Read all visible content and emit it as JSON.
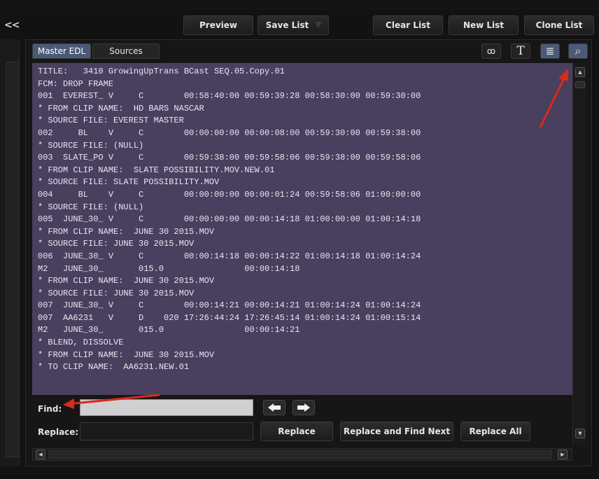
{
  "window": {
    "back_label": "<<"
  },
  "toolbar": {
    "preview": "Preview",
    "save_list": "Save List",
    "clear_list": "Clear List",
    "new_list": "New List",
    "clone_list": "Clone List"
  },
  "tabs": [
    {
      "label": "Master EDL",
      "active": true
    },
    {
      "label": "Sources",
      "active": false
    }
  ],
  "view_tools": [
    {
      "icon": "tape-icon",
      "glyph": "ꝏ",
      "active": false
    },
    {
      "icon": "text-icon",
      "glyph": "T",
      "active": false
    },
    {
      "icon": "edit-list-icon",
      "glyph": "≣",
      "active": true
    },
    {
      "icon": "search-icon",
      "glyph": "⌕",
      "active": true
    }
  ],
  "edl_lines": [
    "TITLE:   3410 GrowingUpTrans BCast SEQ.05.Copy.01",
    "FCM: DROP FRAME",
    "001  EVEREST_ V     C        00:58:40:00 00:59:39:28 00:58:30:00 00:59:30:00",
    "* FROM CLIP NAME:  HD BARS NASCAR",
    "* SOURCE FILE: EVEREST MASTER",
    "002     BL    V     C        00:00:00:00 00:00:08:00 00:59:30:00 00:59:38:00",
    "* SOURCE FILE: (NULL)",
    "003  SLATE_PO V     C        00:59:38:00 00:59:58:06 00:59:38:00 00:59:58:06",
    "* FROM CLIP NAME:  SLATE POSSIBILITY.MOV.NEW.01",
    "* SOURCE FILE: SLATE POSSIBILITY.MOV",
    "004     BL    V     C        00:00:00:00 00:00:01:24 00:59:58:06 01:00:00:00",
    "* SOURCE FILE: (NULL)",
    "005  JUNE_30_ V     C        00:00:00:00 00:00:14:18 01:00:00:00 01:00:14:18",
    "* FROM CLIP NAME:  JUNE 30 2015.MOV",
    "* SOURCE FILE: JUNE 30 2015.MOV",
    "006  JUNE_30_ V     C        00:00:14:18 00:00:14:22 01:00:14:18 01:00:14:24",
    "M2   JUNE_30_       015.0                00:00:14:18",
    "* FROM CLIP NAME:  JUNE 30 2015.MOV",
    "* SOURCE FILE: JUNE 30 2015.MOV",
    "007  JUNE_30_ V     C        00:00:14:21 00:00:14:21 01:00:14:24 01:00:14:24",
    "007  AA6231   V     D    020 17:26:44:24 17:26:45:14 01:00:14:24 01:00:15:14",
    "M2   JUNE_30_       015.0                00:00:14:21",
    "* BLEND, DISSOLVE",
    "* FROM CLIP NAME:  JUNE 30 2015.MOV",
    "* TO CLIP NAME:  AA6231.NEW.01"
  ],
  "find": {
    "label": "Find:",
    "value": ""
  },
  "replace": {
    "label": "Replace:",
    "value": ""
  },
  "actions": {
    "replace": "Replace",
    "replace_find_next": "Replace and Find Next",
    "replace_all": "Replace All"
  },
  "colors": {
    "edl_background": "#48405e",
    "active_tab": "#4a5a78",
    "annotation_arrow": "#d92a1c"
  }
}
